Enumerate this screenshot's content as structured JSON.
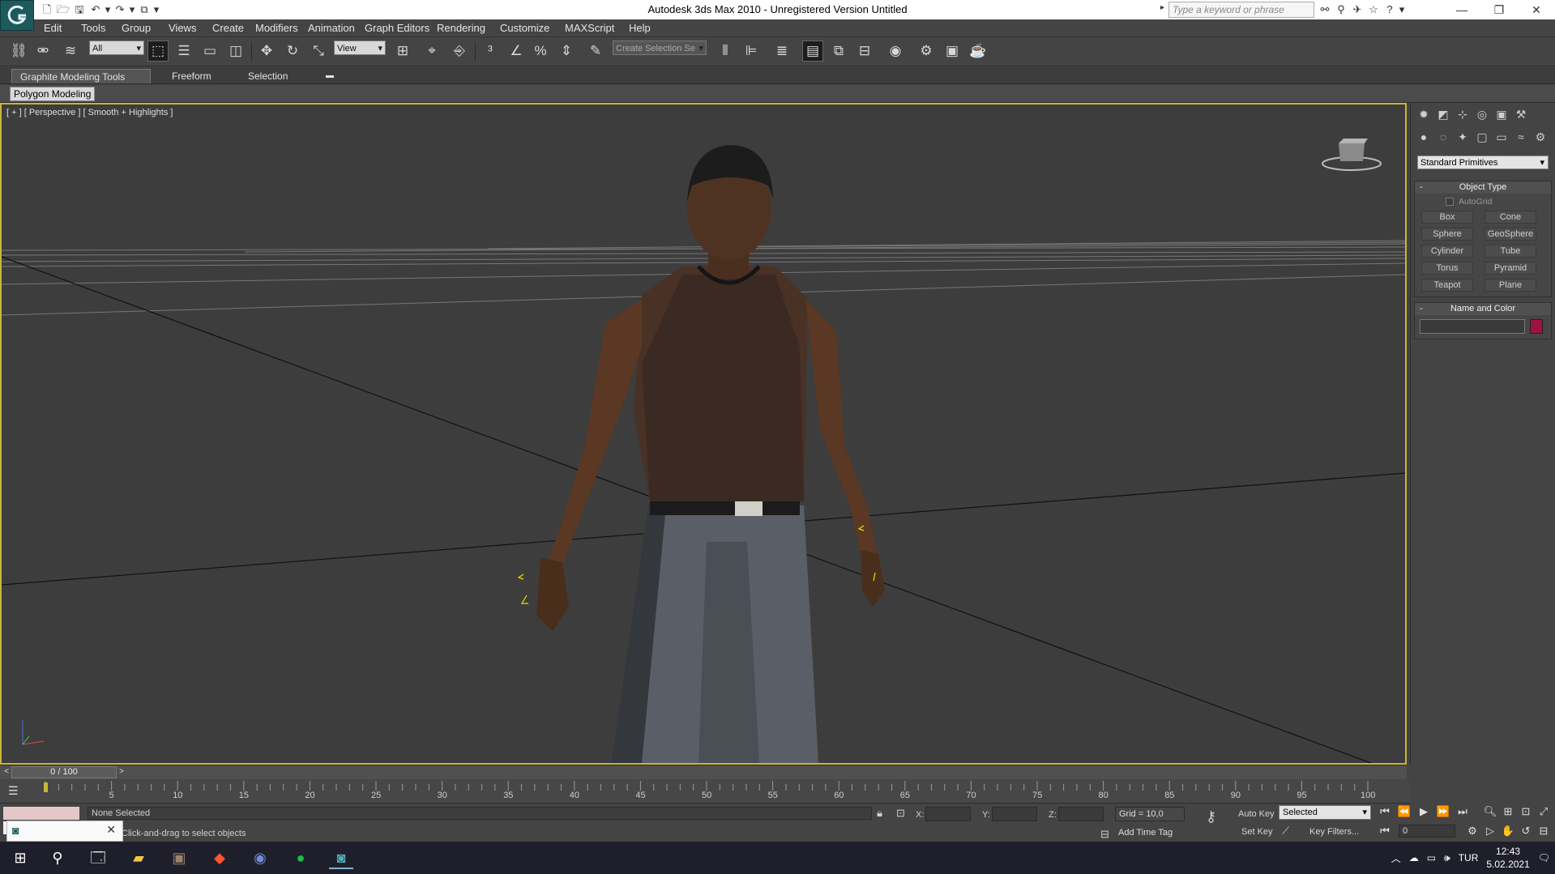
{
  "title": "Autodesk 3ds Max  2010    -  Unregistered Version      Untitled",
  "search_placeholder": "Type a keyword or phrase",
  "menu": [
    "Edit",
    "Tools",
    "Group",
    "Views",
    "Create",
    "Modifiers",
    "Animation",
    "Graph Editors",
    "Rendering",
    "Customize",
    "MAXScript",
    "Help"
  ],
  "toolbar": {
    "selection_filter": "All",
    "ref_coord": "View",
    "named_selection": "Create Selection Se"
  },
  "ribbon": {
    "tabs": [
      "Graphite Modeling Tools",
      "Freeform",
      "Selection"
    ],
    "active_tab": "Graphite Modeling Tools",
    "panel": "Polygon Modeling"
  },
  "viewport": {
    "label": "[ + ] [ Perspective ] [ Smooth + Highlights ]"
  },
  "command_panel": {
    "category": "Standard Primitives",
    "object_type": {
      "title": "Object Type",
      "autogrid": "AutoGrid",
      "buttons": [
        "Box",
        "Cone",
        "Sphere",
        "GeoSphere",
        "Cylinder",
        "Tube",
        "Torus",
        "Pyramid",
        "Teapot",
        "Plane"
      ]
    },
    "name_color": {
      "title": "Name and Color",
      "color": "#a0123e"
    }
  },
  "timeline": {
    "frame": "0 / 100",
    "ticks": [
      "5",
      "10",
      "15",
      "20",
      "25",
      "30",
      "35",
      "40",
      "45",
      "50",
      "55",
      "60",
      "65",
      "70",
      "75",
      "80",
      "85",
      "90",
      "95",
      "100"
    ]
  },
  "status": {
    "selection": "None Selected",
    "prompt": "Click-and-drag to select objects",
    "x_label": "X:",
    "y_label": "Y:",
    "z_label": "Z:",
    "grid": "Grid = 10,0",
    "add_time_tag": "Add Time Tag",
    "auto_key": "Auto Key",
    "set_key": "Set Key",
    "key_mode": "Selected",
    "key_filters": "Key Filters...",
    "current_frame": "0"
  },
  "taskbar": {
    "language": "TUR",
    "time": "12:43",
    "date": "5.02.2021"
  }
}
